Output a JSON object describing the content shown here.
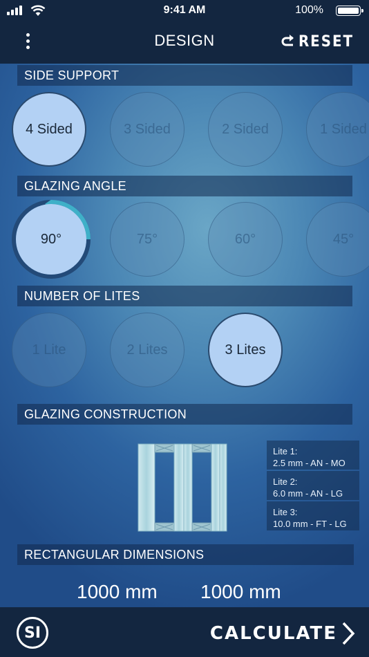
{
  "status_bar": {
    "time": "9:41 AM",
    "battery": "100%"
  },
  "header": {
    "title": "DESIGN",
    "reset_label": "RESET"
  },
  "side_support": {
    "title": "SIDE SUPPORT",
    "options": [
      "4 Sided",
      "3 Sided",
      "2 Sided",
      "1 Sided"
    ],
    "selected": "4 Sided"
  },
  "glazing_angle": {
    "title": "GLAZING ANGLE",
    "options": [
      "90°",
      "75°",
      "60°",
      "45°"
    ],
    "selected": "90°"
  },
  "number_of_lites": {
    "title": "NUMBER OF LITES",
    "options": [
      "1 Lite",
      "2 Lites",
      "3 Lites"
    ],
    "selected": "3 Lites"
  },
  "glazing_construction": {
    "title": "GLAZING CONSTRUCTION",
    "lites": [
      {
        "name": "Lite 1:",
        "spec": "2.5 mm - AN - MO"
      },
      {
        "name": "Lite 2:",
        "spec": "6.0 mm - AN - LG"
      },
      {
        "name": "Lite 3:",
        "spec": "10.0 mm - FT - LG"
      }
    ]
  },
  "rectangular_dimensions": {
    "title": "RECTANGULAR DIMENSIONS",
    "width": "1000 mm",
    "height": "1000 mm"
  },
  "footer": {
    "units_label": "SI",
    "calculate_label": "CALCULATE"
  },
  "colors": {
    "accent": "#3fb0c8",
    "selected_fill": "#b3d1f4",
    "bar_bg": "#132640"
  },
  "icons": [
    "menu-icon",
    "reset-icon",
    "chevron-right-icon",
    "signal-icon",
    "wifi-icon",
    "battery-icon"
  ]
}
